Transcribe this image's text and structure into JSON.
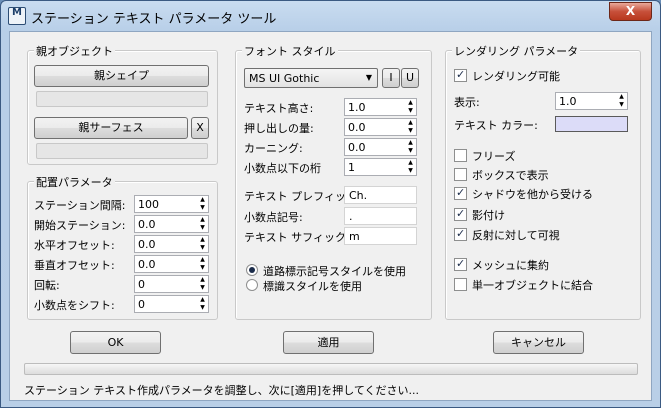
{
  "window": {
    "icon_letters": "M",
    "title": "ステーション テキスト パラメータ ツール",
    "close_symbol": "X"
  },
  "parent_object": {
    "title": "親オブジェクト",
    "shape_button": "親シェイプ",
    "surface_button": "親サーフェス",
    "surface_clear": "X"
  },
  "placement": {
    "title": "配置パラメータ",
    "fields": [
      {
        "label": "ステーション間隔:",
        "value": "100"
      },
      {
        "label": "開始ステーション:",
        "value": "0.0"
      },
      {
        "label": "水平オフセット:",
        "value": "0.0"
      },
      {
        "label": "垂直オフセット:",
        "value": "0.0"
      },
      {
        "label": "回転:",
        "value": "0"
      },
      {
        "label": "小数点をシフト:",
        "value": "0"
      }
    ]
  },
  "font_style": {
    "title": "フォント スタイル",
    "font_name": "MS UI Gothic",
    "italic_button": "I",
    "underline_button": "U",
    "numeric_fields": [
      {
        "label": "テキスト高さ:",
        "value": "1.0"
      },
      {
        "label": "押し出しの量:",
        "value": "0.0"
      },
      {
        "label": "カーニング:",
        "value": "0.0"
      },
      {
        "label": "小数点以下の桁",
        "value": "1"
      }
    ],
    "text_fields": [
      {
        "label": "テキスト プレフィックス",
        "value": "Ch."
      },
      {
        "label": "小数点記号:",
        "value": "."
      },
      {
        "label": "テキスト サフィックス",
        "value": "m"
      }
    ],
    "radio_options": [
      {
        "label": "道路標示記号スタイルを使用",
        "selected": true
      },
      {
        "label": "標識スタイルを使用",
        "selected": false
      }
    ]
  },
  "rendering": {
    "title": "レンダリング パラメータ",
    "renderable": {
      "label": "レンダリング可能",
      "checked": true
    },
    "display_label": "表示:",
    "display_value": "1.0",
    "text_color_label": "テキスト カラー:",
    "text_color": "#dcdcf8",
    "options": [
      {
        "label": "フリーズ",
        "checked": false
      },
      {
        "label": "ボックスで表示",
        "checked": false
      },
      {
        "label": "シャドウを他から受ける",
        "checked": true
      },
      {
        "label": "影付け",
        "checked": true
      },
      {
        "label": "反射に対して可視",
        "checked": true
      }
    ],
    "mesh_options": [
      {
        "label": "メッシュに集約",
        "checked": true
      },
      {
        "label": "単一オブジェクトに結合",
        "checked": false
      }
    ]
  },
  "actions": {
    "ok": "OK",
    "apply": "適用",
    "cancel": "キャンセル"
  },
  "status_text": "ステーション テキスト作成パラメータを調整し、次に[適用]を押してください..."
}
